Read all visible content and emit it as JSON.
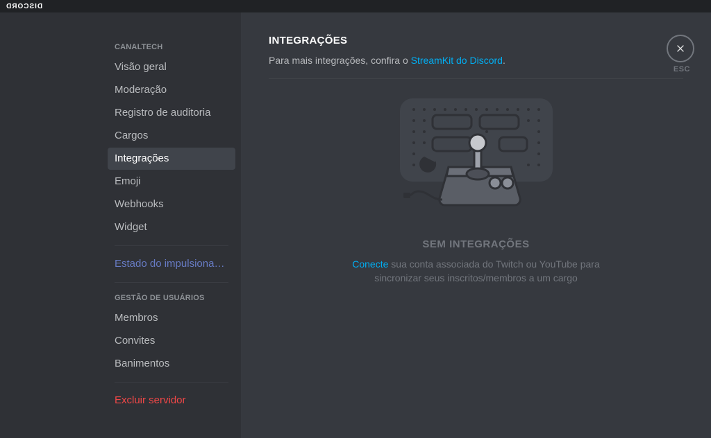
{
  "app": {
    "wordmark": "DISCORD"
  },
  "sidebar": {
    "group1_header": "CANALTECH",
    "items1": {
      "overview": "Visão geral",
      "moderation": "Moderação",
      "audit": "Registro de auditoria",
      "roles": "Cargos",
      "integrations": "Integrações",
      "emoji": "Emoji",
      "webhooks": "Webhooks",
      "widget": "Widget"
    },
    "premium": "Estado do impulsionam…",
    "group2_header": "GESTÃO DE USUÁRIOS",
    "items2": {
      "members": "Membros",
      "invites": "Convites",
      "bans": "Banimentos"
    },
    "delete": "Excluir servidor"
  },
  "close": {
    "esc": "ESC"
  },
  "page": {
    "title": "INTEGRAÇÕES",
    "sub_prefix": "Para mais integrações, confira o ",
    "sub_link": "StreamKit do Discord",
    "sub_suffix": "."
  },
  "empty": {
    "title": "SEM INTEGRAÇÕES",
    "link": "Conecte",
    "body": " sua conta associada do Twitch ou YouTube para sincronizar seus inscritos/membros a um cargo"
  }
}
